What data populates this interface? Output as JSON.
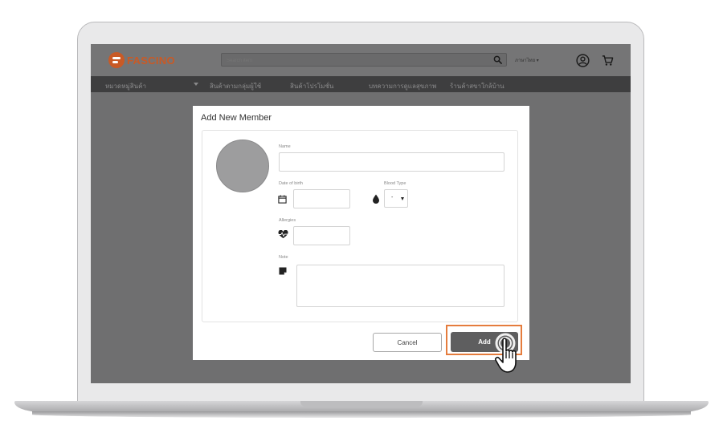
{
  "header": {
    "logo_text": "FASCINO",
    "search_placeholder": "Search item",
    "language": "ภาษาไทย ▾"
  },
  "nav": {
    "items": [
      "หมวดหมู่สินค้า",
      "สินค้าตามกลุ่มผู้ใช้",
      "สินค้าโปรโมชั่น",
      "บทความการดูแลสุขภาพ",
      "ร้านค้าสขาใกล้บ้าน"
    ]
  },
  "modal": {
    "title": "Add New Member",
    "name_label": "Name",
    "name_value": "",
    "dob_label": "Date of birth",
    "dob_value": "",
    "blood_type_label": "Blood Type",
    "blood_type_value": "-",
    "allergies_label": "Allergies",
    "allergies_value": "",
    "note_label": "Note",
    "note_value": "",
    "cancel_label": "Cancel",
    "add_label": "Add"
  },
  "colors": {
    "accent": "#e57c3d",
    "brand": "#c95a26",
    "add_button": "#5e5e5f"
  },
  "icons": {
    "calendar": "calendar-icon",
    "blood": "blood-drop-icon",
    "allergy": "heartbeat-icon",
    "note": "note-icon",
    "search": "search-icon",
    "user": "user-circle-icon",
    "cart": "cart-icon",
    "cursor": "hand-pointer-icon"
  }
}
